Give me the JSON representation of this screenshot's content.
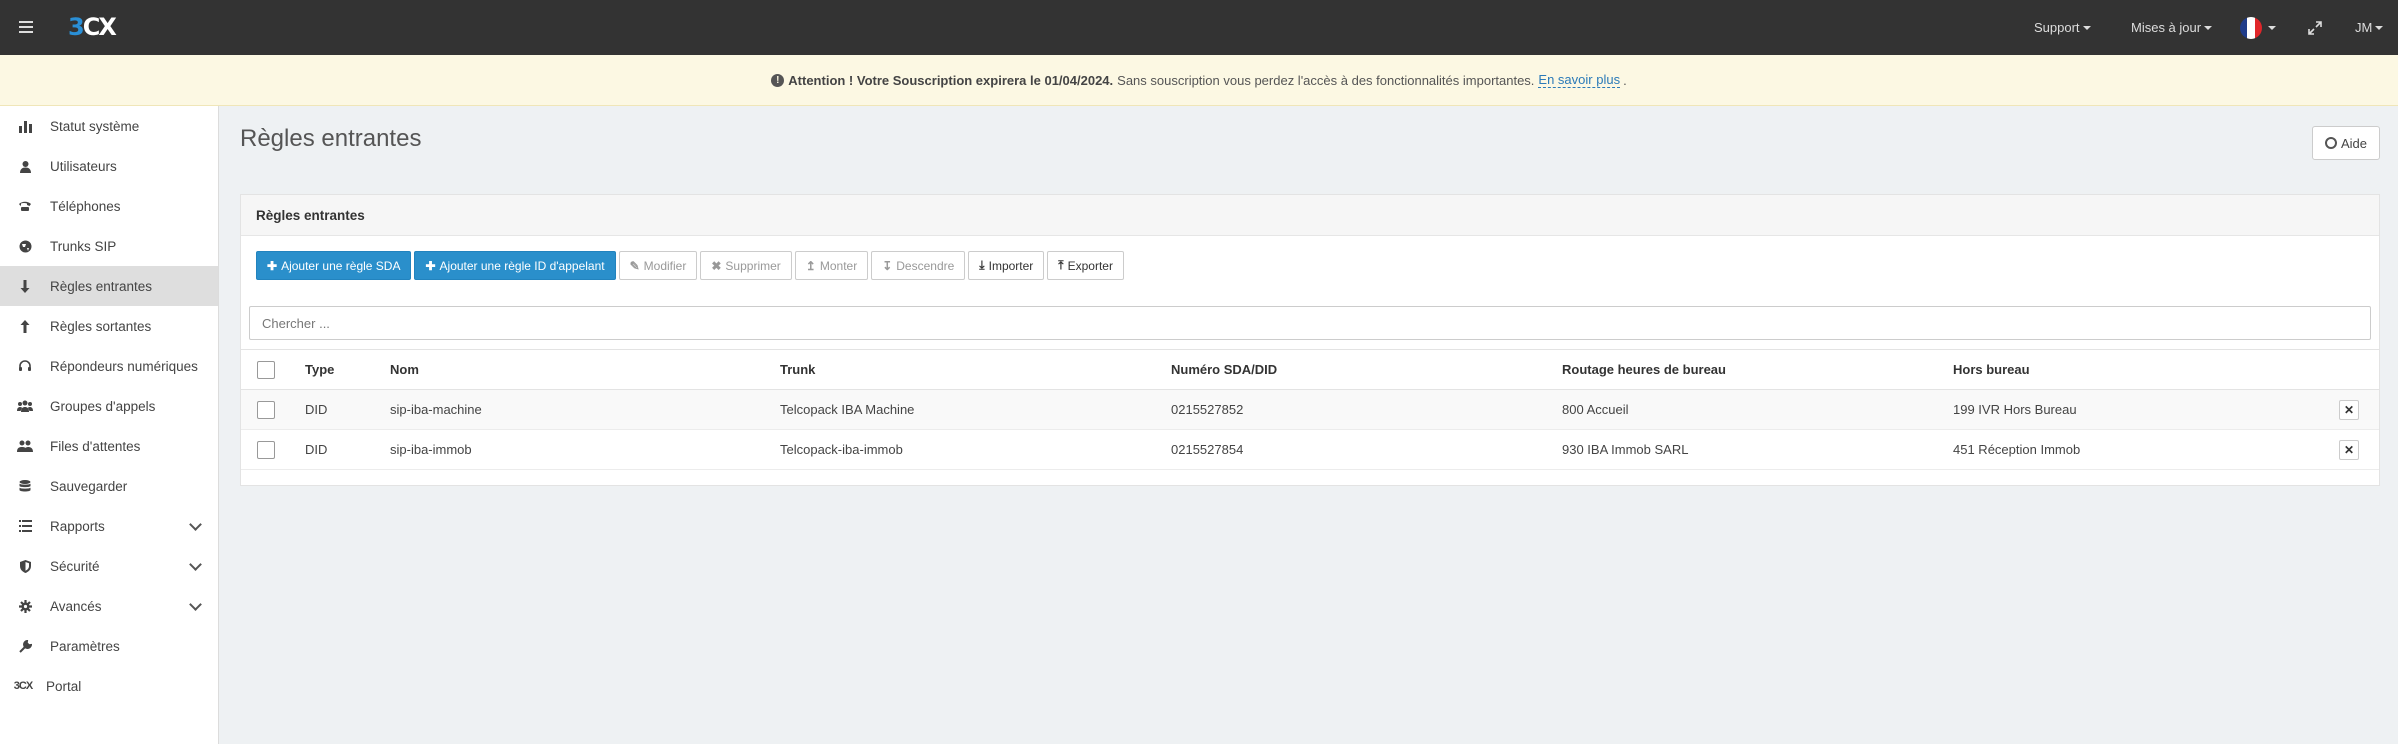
{
  "topbar": {
    "logo": "3CX",
    "support": "Support",
    "updates": "Mises à jour",
    "user": "JM",
    "flag_colors": [
      "#1f3c8a",
      "#ffffff",
      "#e0262a"
    ]
  },
  "banner": {
    "title": "Attention ! Votre Souscription expirera le 01/04/2024.",
    "text": "Sans souscription vous perdez l'accès à des fonctionnalités importantes.",
    "link": "En savoir plus",
    "after": "."
  },
  "sidebar": {
    "items": [
      {
        "label": "Statut système",
        "icon": "bar-chart-icon"
      },
      {
        "label": "Utilisateurs",
        "icon": "user-icon"
      },
      {
        "label": "Téléphones",
        "icon": "phone-icon"
      },
      {
        "label": "Trunks SIP",
        "icon": "globe-icon"
      },
      {
        "label": "Règles entrantes",
        "icon": "arrow-down-icon"
      },
      {
        "label": "Règles sortantes",
        "icon": "arrow-up-icon"
      },
      {
        "label": "Répondeurs numériques",
        "icon": "headset-icon"
      },
      {
        "label": "Groupes d'appels",
        "icon": "users-icon"
      },
      {
        "label": "Files d'attentes",
        "icon": "group-icon"
      },
      {
        "label": "Sauvegarder",
        "icon": "database-icon"
      },
      {
        "label": "Rapports",
        "icon": "list-icon"
      },
      {
        "label": "Sécurité",
        "icon": "shield-icon"
      },
      {
        "label": "Avancés",
        "icon": "gear-icon"
      },
      {
        "label": "Paramètres",
        "icon": "wrench-icon"
      },
      {
        "label": "Portal",
        "icon": "3cx-icon",
        "icon_text": "3CX"
      }
    ]
  },
  "page": {
    "title": "Règles entrantes",
    "help": "Aide"
  },
  "panel": {
    "title": "Règles entrantes",
    "buttons": {
      "add_sda": "Ajouter une règle SDA",
      "add_callerid": "Ajouter une règle ID d'appelant",
      "edit": "Modifier",
      "delete": "Supprimer",
      "up": "Monter",
      "down": "Descendre",
      "import": "Importer",
      "export": "Exporter"
    },
    "search_placeholder": "Chercher ...",
    "columns": [
      "Type",
      "Nom",
      "Trunk",
      "Numéro SDA/DID",
      "Routage heures de bureau",
      "Hors bureau"
    ],
    "rows": [
      {
        "type": "DID",
        "name": "sip-iba-machine",
        "trunk": "Telcopack IBA Machine",
        "number": "0215527852",
        "office": "800 Accueil",
        "out": "199 IVR Hors Bureau"
      },
      {
        "type": "DID",
        "name": "sip-iba-immob",
        "trunk": "Telcopack-iba-immob",
        "number": "0215527854",
        "office": "930 IBA Immob SARL",
        "out": "451 Réception Immob"
      }
    ]
  }
}
